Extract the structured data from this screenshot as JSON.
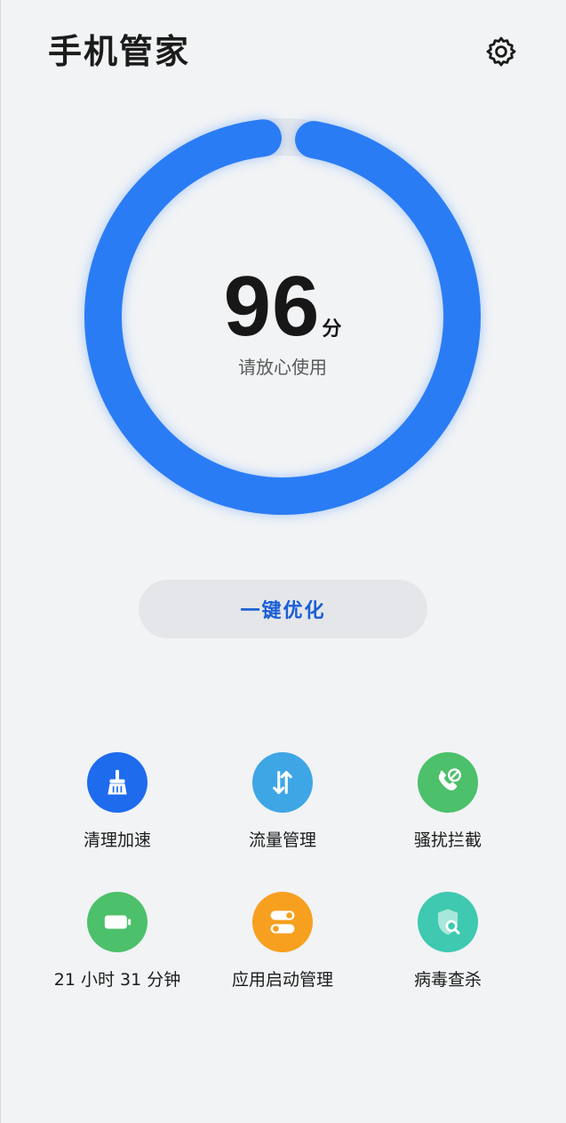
{
  "header": {
    "title": "手机管家",
    "settings_icon": "gear-icon"
  },
  "score": {
    "value": "96",
    "unit": "分",
    "status": "请放心使用",
    "fraction": 0.96,
    "color": "#2a7cf5"
  },
  "optimize_button": {
    "label": "一键优化"
  },
  "tools": [
    {
      "label": "清理加速",
      "icon": "broom-icon",
      "color": "#1f6bee"
    },
    {
      "label": "流量管理",
      "icon": "data-traffic-icon",
      "color": "#3fa6e6"
    },
    {
      "label": "骚扰拦截",
      "icon": "phone-block-icon",
      "color": "#4cc06a"
    },
    {
      "label": "21 小时 31 分钟",
      "icon": "battery-icon",
      "color": "#4cc06a"
    },
    {
      "label": "应用启动管理",
      "icon": "toggle-switch-icon",
      "color": "#f7a020"
    },
    {
      "label": "病毒查杀",
      "icon": "shield-search-icon",
      "color": "#3ec9b0"
    }
  ]
}
